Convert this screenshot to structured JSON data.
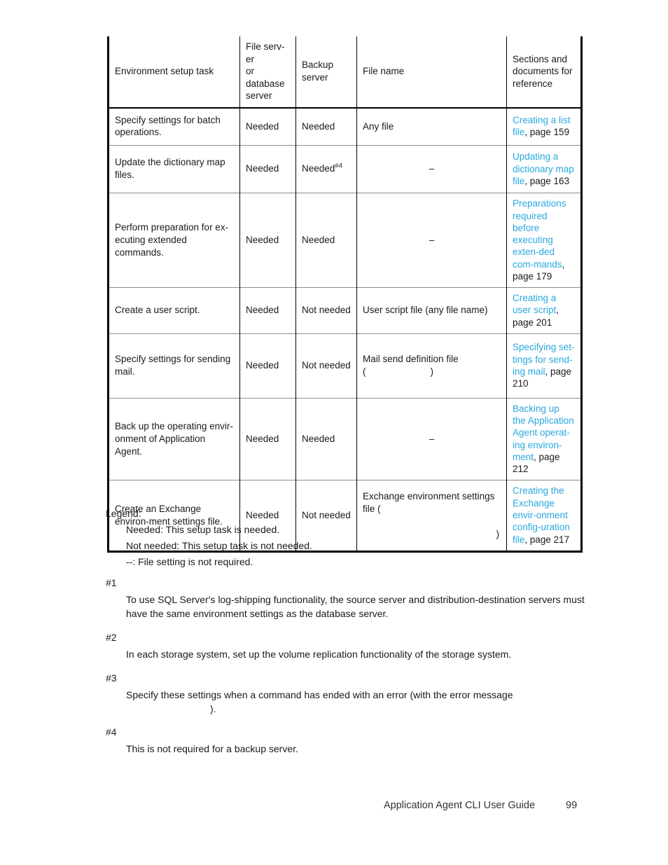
{
  "document": {
    "footer_title": "Application Agent CLI User Guide",
    "page_number": "99",
    "link_color": "#29a8e0"
  },
  "table": {
    "headers": {
      "task": "Environment setup task",
      "file_or_db_server": "File serv-\ner\nor\ndatabase\nserver",
      "backup_server": "Backup\nserver",
      "file_name": "File name",
      "sections": "Sections and\ndocuments for\nreference"
    },
    "rows": [
      {
        "task": "Specify settings for batch operations.",
        "server": "Needed",
        "server_footnote": "",
        "backup": "Needed",
        "backup_footnote": "",
        "file_name": "Any file",
        "file_name_paren": "",
        "file_name_paren_tail": "",
        "ref_link": "Creating a list file",
        "ref_page": ", page 159"
      },
      {
        "task": "Update the dictionary map files.",
        "server": "Needed",
        "server_footnote": "",
        "backup": "Needed",
        "backup_footnote": "#4",
        "file_name": "–",
        "file_name_paren": "",
        "file_name_paren_tail": "",
        "ref_link": "Updating a dictionary map file",
        "ref_page": ", page 163"
      },
      {
        "task": "Perform preparation for ex-ecuting extended commands.",
        "server": "Needed",
        "server_footnote": "",
        "backup": "Needed",
        "backup_footnote": "",
        "file_name": "–",
        "file_name_paren": "",
        "file_name_paren_tail": "",
        "ref_link": "Preparations required before executing exten-ded com-mands",
        "ref_page": ", page 179"
      },
      {
        "task": "Create a user script.",
        "server": "Needed",
        "server_footnote": "",
        "backup": "Not needed",
        "backup_footnote": "",
        "file_name": "User script file (any file name)",
        "file_name_paren": "",
        "file_name_paren_tail": "",
        "ref_link": "Creating a user script",
        "ref_page": ", page 201"
      },
      {
        "task": "Specify settings for sending mail.",
        "server": "Needed",
        "server_footnote": "",
        "backup": "Not needed",
        "backup_footnote": "",
        "file_name": "Mail send definition file",
        "file_name_paren": "(",
        "file_name_paren_tail": ")",
        "ref_link": "Specifying set-tings for send-ing mail",
        "ref_page": ", page 210"
      },
      {
        "task": "Back up the operating envir-onment of Application Agent.",
        "server": "Needed",
        "server_footnote": "",
        "backup": "Needed",
        "backup_footnote": "",
        "file_name": "–",
        "file_name_paren": "",
        "file_name_paren_tail": "",
        "ref_link": "Backing up the Application Agent operat-ing environ-ment",
        "ref_page": ", page 212"
      },
      {
        "task": "Create an Exchange environ-ment settings file.",
        "server": "Needed",
        "server_footnote": "",
        "backup": "Not needed",
        "backup_footnote": "",
        "file_name": "Exchange environment settings file (",
        "file_name_paren": "",
        "file_name_paren_tail": ")",
        "ref_link": "Creating the Exchange envir-onment config-uration file",
        "ref_page": ", page 217"
      }
    ]
  },
  "legend": {
    "title": "Legend:",
    "items": [
      "Needed: This setup task is needed.",
      "Not needed: This setup task is not needed.",
      "--: File setting is not required."
    ]
  },
  "footnotes": [
    {
      "marker": "#1",
      "text": "To use SQL Server's log-shipping functionality, the source server and distribution-destination servers must have the same environment settings as the database server.",
      "gap_text": ""
    },
    {
      "marker": "#2",
      "text": "In each storage system, set up the volume replication functionality of the storage system.",
      "gap_text": ""
    },
    {
      "marker": "#3",
      "text": "Specify these settings when a command has ended with an error (with the error message",
      "gap_text": ")."
    },
    {
      "marker": "#4",
      "text": "This is not required for a backup server.",
      "gap_text": ""
    }
  ]
}
